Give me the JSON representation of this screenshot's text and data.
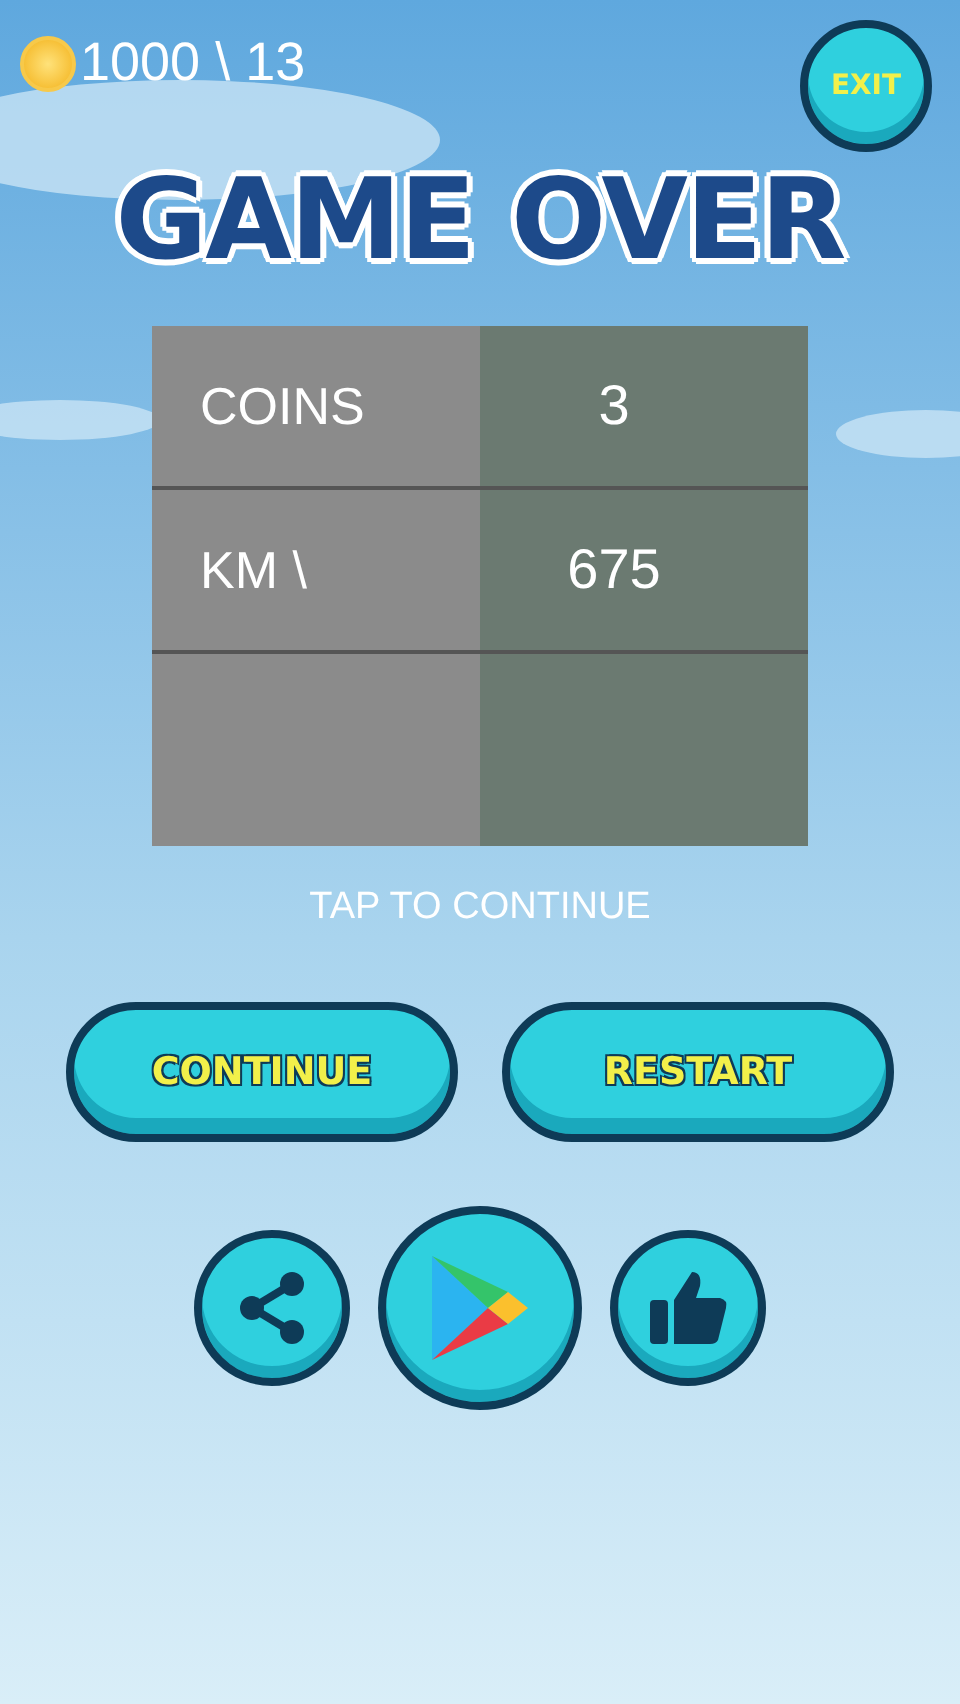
{
  "hud": {
    "coins": "1000 \\ 13"
  },
  "exit_button": "EXIT",
  "title": "GAME OVER",
  "stats": [
    {
      "label": "COINS",
      "value": "3"
    },
    {
      "label": "KM \\",
      "value": "675"
    }
  ],
  "hint": "TAP TO CONTINUE",
  "buttons": [
    "CONTINUE",
    "RESTART"
  ]
}
